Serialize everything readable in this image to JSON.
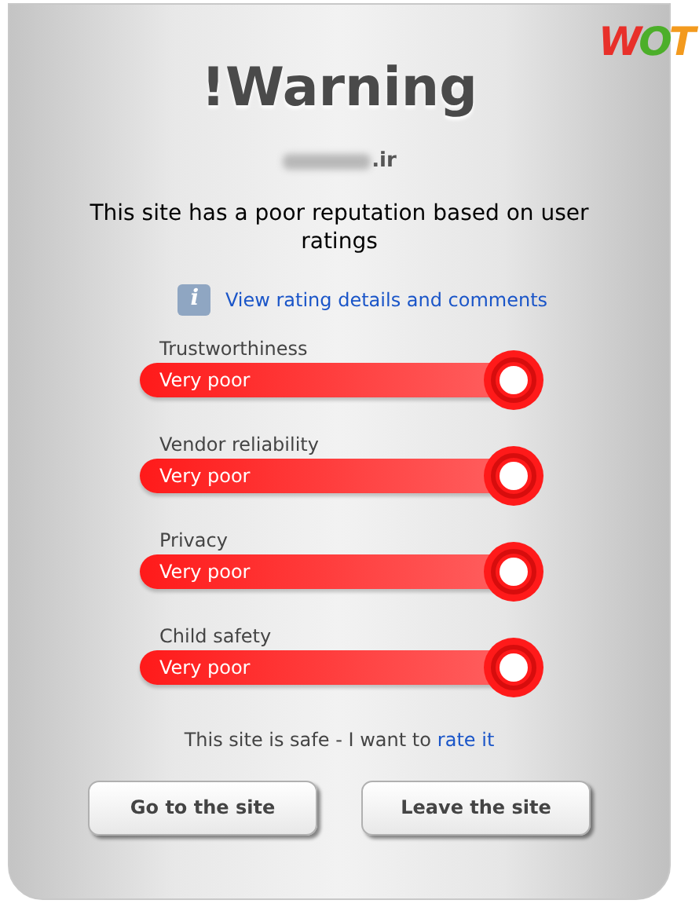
{
  "logo": "WOT",
  "title": "!Warning",
  "domain": ".ir",
  "message": "This site has a poor reputation based on user ratings",
  "info_icon": "i",
  "details_link": "View rating details and comments",
  "ratings": [
    {
      "label": "Trustworthiness",
      "value": "Very poor",
      "color": "#ff1a1a"
    },
    {
      "label": "Vendor reliability",
      "value": "Very poor",
      "color": "#ff1a1a"
    },
    {
      "label": "Privacy",
      "value": "Very poor",
      "color": "#ff1a1a"
    },
    {
      "label": "Child safety",
      "value": "Very poor",
      "color": "#ff1a1a"
    }
  ],
  "safe_text": "This site is safe - I want to",
  "rate_link": "rate it",
  "buttons": [
    "Go to the site",
    "Leave the site"
  ]
}
